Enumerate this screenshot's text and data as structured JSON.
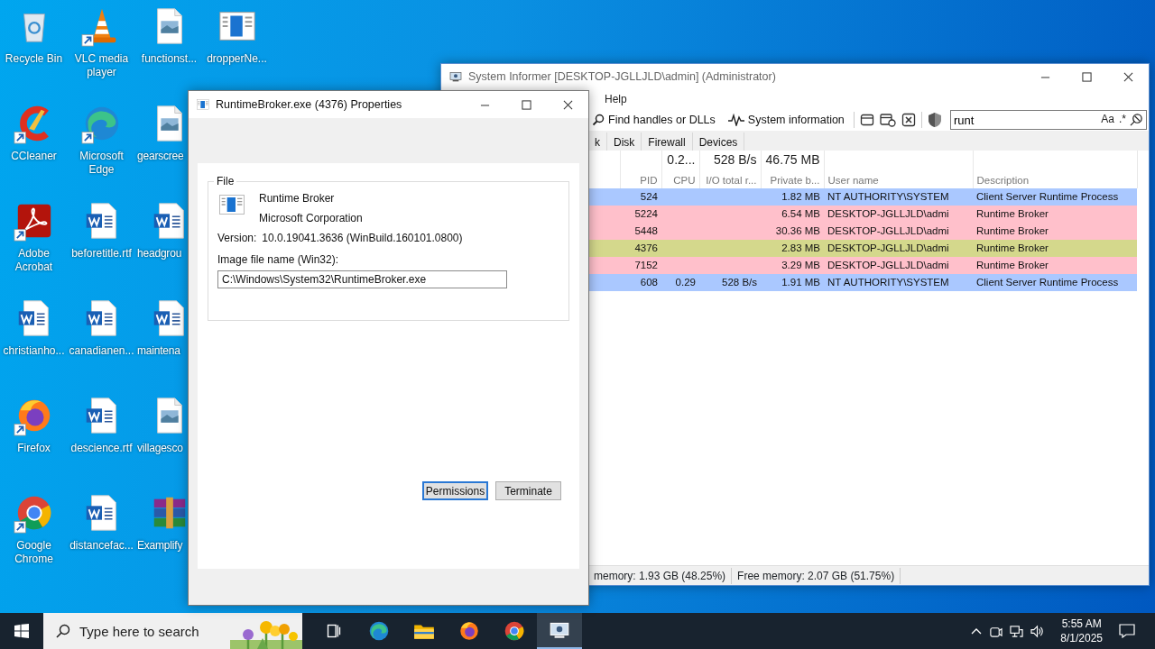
{
  "desktop": {
    "icons": [
      {
        "label": "Recycle Bin",
        "kind": "recycle",
        "shortcut": false
      },
      {
        "label": "CCleaner",
        "kind": "cleaner",
        "shortcut": true
      },
      {
        "label": "Adobe Acrobat",
        "kind": "pdf",
        "shortcut": true
      },
      {
        "label": "christianho...",
        "kind": "word-doc",
        "shortcut": false
      },
      {
        "label": "Firefox",
        "kind": "fox",
        "shortcut": true
      },
      {
        "label": "Google Chrome",
        "kind": "chrome",
        "shortcut": true
      },
      {
        "label": "VLC media player",
        "kind": "cone",
        "shortcut": true
      },
      {
        "label": "Microsoft Edge",
        "kind": "swirl",
        "shortcut": true
      },
      {
        "label": "beforetitle.rtf",
        "kind": "word-doc",
        "shortcut": false
      },
      {
        "label": "canadianen...",
        "kind": "word-doc",
        "shortcut": false
      },
      {
        "label": "descience.rtf",
        "kind": "word-doc",
        "shortcut": false
      },
      {
        "label": "distancefac...",
        "kind": "word-doc",
        "shortcut": false
      },
      {
        "label": "functionst...",
        "kind": "image-file",
        "shortcut": false
      },
      {
        "label": "gearscree",
        "kind": "image-file",
        "shortcut": false
      },
      {
        "label": "headgrou",
        "kind": "word-doc",
        "shortcut": false
      },
      {
        "label": "maintena",
        "kind": "word-doc",
        "shortcut": false
      },
      {
        "label": "villagesco",
        "kind": "image-file",
        "shortcut": false
      },
      {
        "label": "Examplify",
        "kind": "archive",
        "shortcut": false
      },
      {
        "label": "dropperNe...",
        "kind": "app-window",
        "shortcut": false
      }
    ]
  },
  "system_informer": {
    "title": "System Informer [DESKTOP-JGLLJLD\\admin] (Administrator)",
    "menu": [
      "Help"
    ],
    "toolbar": [
      {
        "label": "Find handles or DLLs",
        "kind": "search"
      },
      {
        "label": "System information",
        "kind": "pulse"
      }
    ],
    "search": {
      "value": "runt",
      "options": [
        "Aa",
        ".*"
      ]
    },
    "tabs": [
      {
        "label": "k",
        "selected": false
      },
      {
        "label": "Disk",
        "selected": false
      },
      {
        "label": "Firewall",
        "selected": false
      },
      {
        "label": "Devices",
        "selected": false
      }
    ],
    "table": {
      "columns": [
        {
          "label": "PID"
        },
        {
          "label": "CPU",
          "total": "0.2..."
        },
        {
          "label": "I/O total r...",
          "total": "528 B/s"
        },
        {
          "label": "Private b...",
          "total": "46.75 MB"
        },
        {
          "label": "User name"
        },
        {
          "label": "Description"
        }
      ],
      "rows": [
        {
          "pid": "524",
          "private": "1.82 MB",
          "user": "NT AUTHORITY\\SYSTEM",
          "description": "Client Server Runtime Process",
          "color": "#aac8ff"
        },
        {
          "pid": "5224",
          "private": "6.54 MB",
          "user": "DESKTOP-JGLLJLD\\admi",
          "description": "Runtime Broker",
          "color": "#ffc0cb"
        },
        {
          "pid": "5448",
          "private": "30.36 MB",
          "user": "DESKTOP-JGLLJLD\\admi",
          "description": "Runtime Broker",
          "color": "#ffc0cb"
        },
        {
          "pid": "4376",
          "private": "2.83 MB",
          "user": "DESKTOP-JGLLJLD\\admi",
          "description": "Runtime Broker",
          "color": "#d4d88c"
        },
        {
          "pid": "7152",
          "private": "3.29 MB",
          "user": "DESKTOP-JGLLJLD\\admi",
          "description": "Runtime Broker",
          "color": "#ffc0cb"
        },
        {
          "pid": "608",
          "cpu": "0.29",
          "io": "528 B/s",
          "private": "1.91 MB",
          "user": "NT AUTHORITY\\SYSTEM",
          "description": "Client Server Runtime Process",
          "color": "#aac8ff"
        }
      ]
    },
    "status_bar": [
      "memory: 1.93 GB (48.25%)",
      "Free memory: 2.07 GB (51.75%)"
    ]
  },
  "properties": {
    "title": "RuntimeBroker.exe (4376) Properties",
    "group": "File",
    "file_description": "Runtime Broker",
    "company": "Microsoft Corporation",
    "version_label": "Version:",
    "version": "10.0.19041.3636 (WinBuild.160101.0800)",
    "path_label": "Image file name (Win32):",
    "path": "C:\\Windows\\System32\\RuntimeBroker.exe",
    "buttons": [
      {
        "label": "Permissions",
        "default": true
      },
      {
        "label": "Terminate",
        "default": false
      }
    ]
  },
  "taskbar": {
    "search": {
      "placeholder": "Type here to search"
    },
    "apps": [
      {
        "kind": "task-view",
        "active": false
      },
      {
        "kind": "swirl",
        "active": false
      },
      {
        "kind": "folder",
        "active": false
      },
      {
        "kind": "fox",
        "active": false
      },
      {
        "kind": "chrome",
        "active": false
      },
      {
        "kind": "monitor",
        "active": true
      }
    ],
    "clock": {
      "time": "5:55 AM",
      "date": "8/1/2025"
    }
  }
}
